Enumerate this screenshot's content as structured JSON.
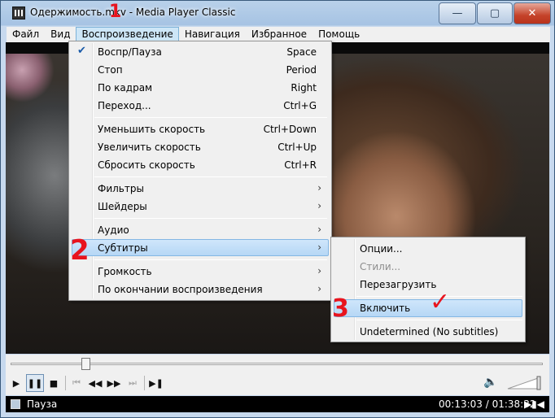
{
  "window": {
    "title": "Одержимость.mkv - Media Player Classic",
    "minimize_glyph": "—",
    "maximize_glyph": "▢",
    "close_glyph": "✕"
  },
  "menubar": {
    "items": [
      "Файл",
      "Вид",
      "Воспроизведение",
      "Навигация",
      "Избранное",
      "Помощь"
    ],
    "active_index": 2
  },
  "playback_menu": {
    "items": [
      {
        "label": "Воспр/Пауза",
        "shortcut": "Space",
        "checked": true
      },
      {
        "label": "Стоп",
        "shortcut": "Period"
      },
      {
        "label": "По кадрам",
        "shortcut": "Right"
      },
      {
        "label": "Переход...",
        "shortcut": "Ctrl+G"
      },
      {
        "label": "Уменьшить скорость",
        "shortcut": "Ctrl+Down"
      },
      {
        "label": "Увеличить скорость",
        "shortcut": "Ctrl+Up"
      },
      {
        "label": "Сбросить скорость",
        "shortcut": "Ctrl+R"
      },
      {
        "label": "Фильтры",
        "submenu": true
      },
      {
        "label": "Шейдеры",
        "submenu": true
      },
      {
        "label": "Аудио",
        "submenu": true
      },
      {
        "label": "Субтитры",
        "submenu": true,
        "highlighted": true
      },
      {
        "label": "Громкость",
        "submenu": true
      },
      {
        "label": "По окончании воспроизведения",
        "submenu": true
      }
    ]
  },
  "subtitles_menu": {
    "items": [
      {
        "label": "Опции..."
      },
      {
        "label": "Стили...",
        "disabled": true
      },
      {
        "label": "Перезагрузить"
      },
      {
        "label": "Включить",
        "highlighted": true
      },
      {
        "label": "Undetermined (No subtitles)"
      }
    ]
  },
  "player": {
    "seek_progress": 0.14
  },
  "status": {
    "state": "Пауза",
    "time": "00:13:03 / 01:38:32"
  },
  "annotations": {
    "a1": "1",
    "a2": "2",
    "a3": "3",
    "check": "✓"
  },
  "colors": {
    "highlight": "#b6d7f5",
    "annotation": "#e8141e"
  }
}
